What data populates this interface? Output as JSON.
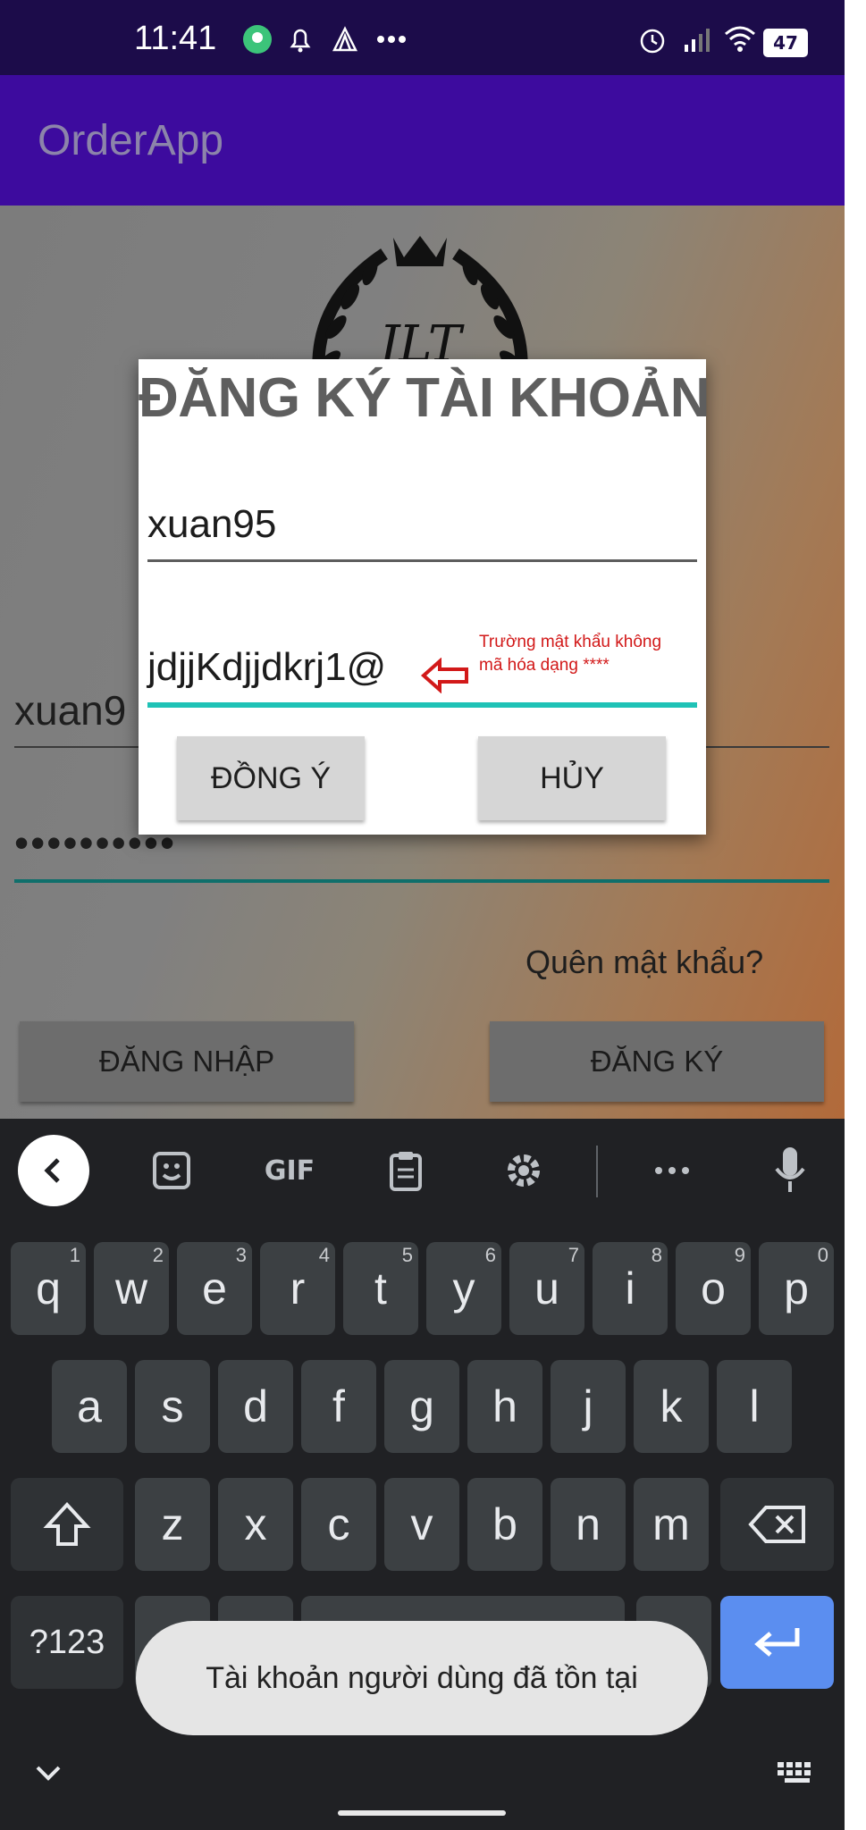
{
  "status_bar": {
    "time": "11:41",
    "battery": "47"
  },
  "app_bar": {
    "title": "OrderApp"
  },
  "login_screen": {
    "logo_text": "JLT",
    "username_value": "xuan9",
    "password_value": "••••••••••",
    "forgot_password": "Quên mật khẩu?",
    "login_button": "ĐĂNG NHẬP",
    "register_button": "ĐĂNG KÝ"
  },
  "dialog": {
    "title": "ĐĂNG KÝ TÀI KHOẢN",
    "username_value": "xuan95",
    "password_value": "jdjjKdjjdkrj1@",
    "confirm_button": "ĐỒNG Ý",
    "cancel_button": "HỦY"
  },
  "annotation": {
    "line1": "Trường mật khẩu không",
    "line2": "mã hóa dạng ****",
    "color": "#d21919"
  },
  "keyboard": {
    "toolbar": {
      "gif": "GIF"
    },
    "row1": [
      {
        "key": "q",
        "hint": "1"
      },
      {
        "key": "w",
        "hint": "2"
      },
      {
        "key": "e",
        "hint": "3"
      },
      {
        "key": "r",
        "hint": "4"
      },
      {
        "key": "t",
        "hint": "5"
      },
      {
        "key": "y",
        "hint": "6"
      },
      {
        "key": "u",
        "hint": "7"
      },
      {
        "key": "i",
        "hint": "8"
      },
      {
        "key": "o",
        "hint": "9"
      },
      {
        "key": "p",
        "hint": "0"
      }
    ],
    "row2": [
      "a",
      "s",
      "d",
      "f",
      "g",
      "h",
      "j",
      "k",
      "l"
    ],
    "row3": [
      "z",
      "x",
      "c",
      "v",
      "b",
      "n",
      "m"
    ],
    "symbols_key": "?123",
    "comma_key": ",",
    "period_key": "."
  },
  "toast": {
    "message": "Tài khoản người dùng đã tồn tại"
  },
  "colors": {
    "status_bar": "#1c0c4a",
    "app_bar": "#3d0b9e",
    "accent_teal": "#1fc2b6",
    "enter_key": "#5b8ef0"
  }
}
